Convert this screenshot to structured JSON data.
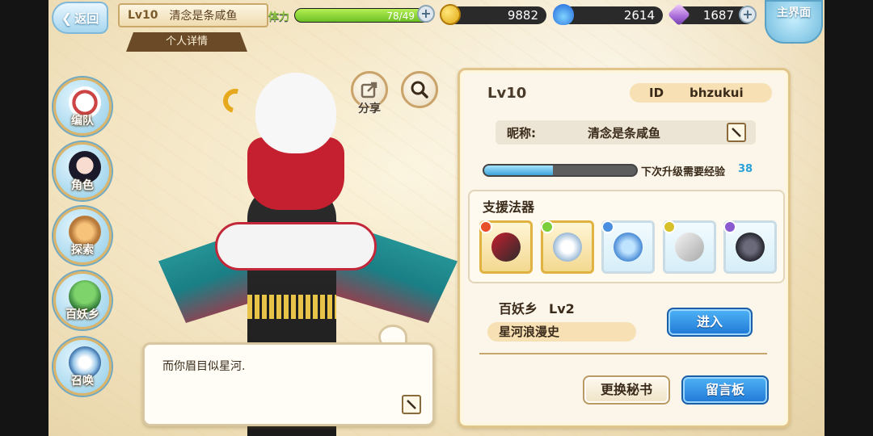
{
  "header": {
    "back_label": "返回",
    "level": "Lv10",
    "player_name": "清念是条咸鱼",
    "sub_label": "个人详情",
    "stamina_label": "体力",
    "stamina_text": "78/49",
    "stamina_fraction": 1.0,
    "gold": "9882",
    "spirit": "2614",
    "gems": "1687",
    "home_label": "主界面"
  },
  "sidebar": {
    "items": [
      {
        "label": "编队"
      },
      {
        "label": "角色"
      },
      {
        "label": "探索"
      },
      {
        "label": "百妖乡"
      },
      {
        "label": "召唤"
      }
    ]
  },
  "character": {
    "share_label": "分享",
    "quote": "而你眉目似星河."
  },
  "profile": {
    "level": "Lv10",
    "id_key": "ID",
    "id_value": "bhzukui",
    "nickname_key": "昵称:",
    "nickname_value": "清念是条咸鱼",
    "exp_label": "下次升级需要经验",
    "exp_value": "38",
    "exp_fraction": 0.45,
    "support_title": "支援法器",
    "artifacts": [
      {
        "icon": "crimson-fan-artifact-icon",
        "badge_color": "#e8502a",
        "frame": "gold"
      },
      {
        "icon": "silver-halo-artifact-icon",
        "badge_color": "#7ccf3a",
        "frame": "gold"
      },
      {
        "icon": "blue-earrings-artifact-icon",
        "badge_color": "#4a8ee0",
        "frame": "blue"
      },
      {
        "icon": "silver-lantern-artifact-icon",
        "badge_color": "#d8c02a",
        "frame": "blue"
      },
      {
        "icon": "black-chain-artifact-icon",
        "badge_color": "#8a5ad0",
        "frame": "blue"
      }
    ],
    "village_label": "百妖乡",
    "village_level": "Lv2",
    "village_name": "星河浪漫史",
    "enter_label": "进入",
    "secretary_label": "更换秘书",
    "board_label": "留言板"
  }
}
